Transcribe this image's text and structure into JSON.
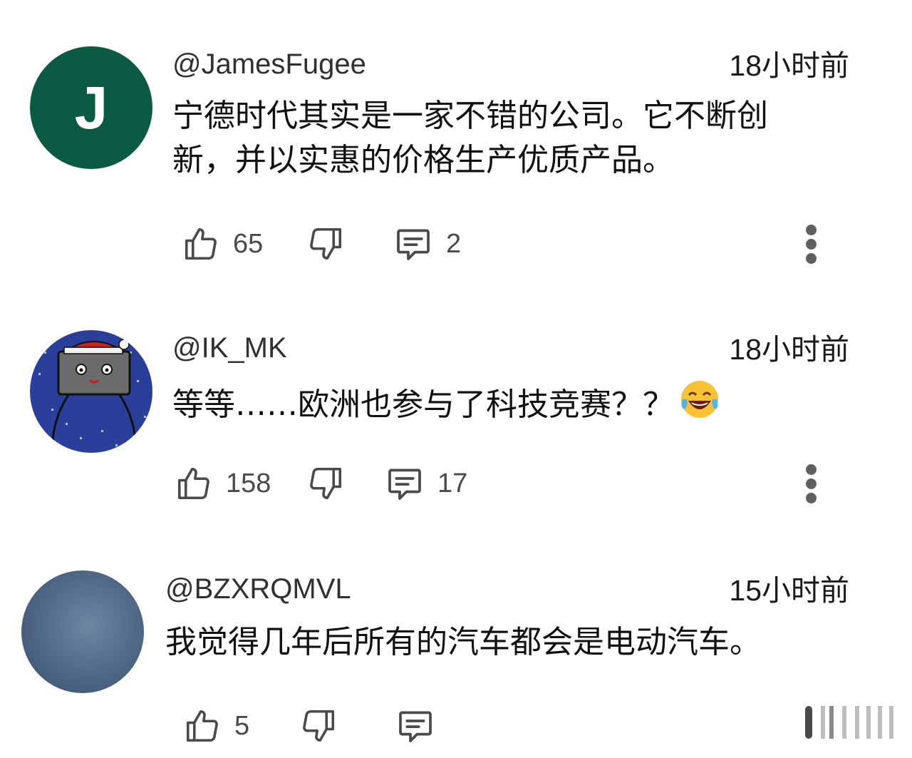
{
  "comments": [
    {
      "handle": "@JamesFugee",
      "time": "18小时前",
      "avatar_letter": "J",
      "text_line1": "宁德时代其实是一家不错的公司。它不断创",
      "text_line2": "新，并以实惠的价格生产优质产品。",
      "likes": "65",
      "replies": "2"
    },
    {
      "handle": "@IK_MK",
      "time": "18小时前",
      "text": "等等……欧洲也参与了科技竞赛？？",
      "emoji": "face-with-tears-of-joy-icon",
      "likes": "158",
      "replies": "17"
    },
    {
      "handle": "@BZXRQMVL",
      "time": "15小时前",
      "text": "我觉得几年后所有的汽车都会是电动汽车。",
      "likes": "5",
      "replies": ""
    }
  ],
  "colors": {
    "avatar_j_bg": "#0b5a43",
    "icon_stroke": "#4a4a4a",
    "text": "#111111"
  },
  "icons": {
    "like": "thumbs-up-icon",
    "dislike": "thumbs-down-icon",
    "reply": "comment-bubble-icon",
    "more": "more-vertical-icon"
  }
}
